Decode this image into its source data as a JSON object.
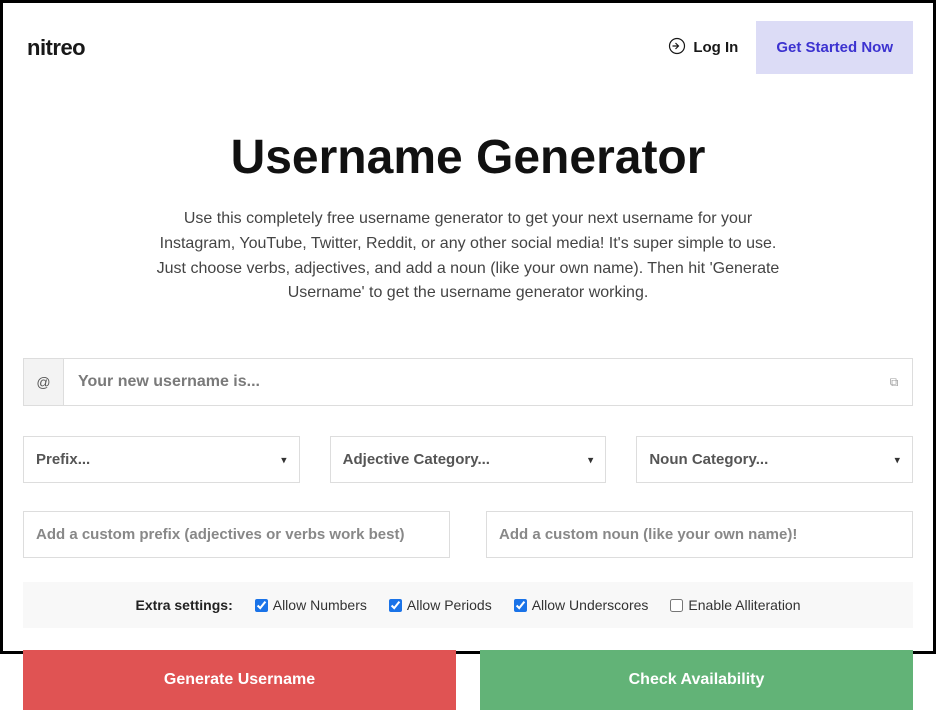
{
  "header": {
    "logo": "nitreo",
    "login_label": "Log In",
    "get_started_label": "Get Started Now"
  },
  "main": {
    "title": "Username Generator",
    "description": "Use this completely free username generator to get your next username for your Instagram, YouTube, Twitter, Reddit, or any other social media! It's super simple to use. Just choose verbs, adjectives, and add a noun (like your own name). Then hit 'Generate Username' to get the username generator working.",
    "at_symbol": "@",
    "username_placeholder": "Your new username is..."
  },
  "selects": {
    "prefix": "Prefix...",
    "adjective": "Adjective Category...",
    "noun": "Noun Category..."
  },
  "custom": {
    "prefix_placeholder": "Add a custom prefix (adjectives or verbs work best)",
    "noun_placeholder": "Add a custom noun (like your own name)!"
  },
  "extra": {
    "label": "Extra settings:",
    "allow_numbers": "Allow Numbers",
    "allow_periods": "Allow Periods",
    "allow_underscores": "Allow Underscores",
    "enable_alliteration": "Enable Alliteration"
  },
  "buttons": {
    "generate": "Generate Username",
    "check": "Check Availability"
  }
}
